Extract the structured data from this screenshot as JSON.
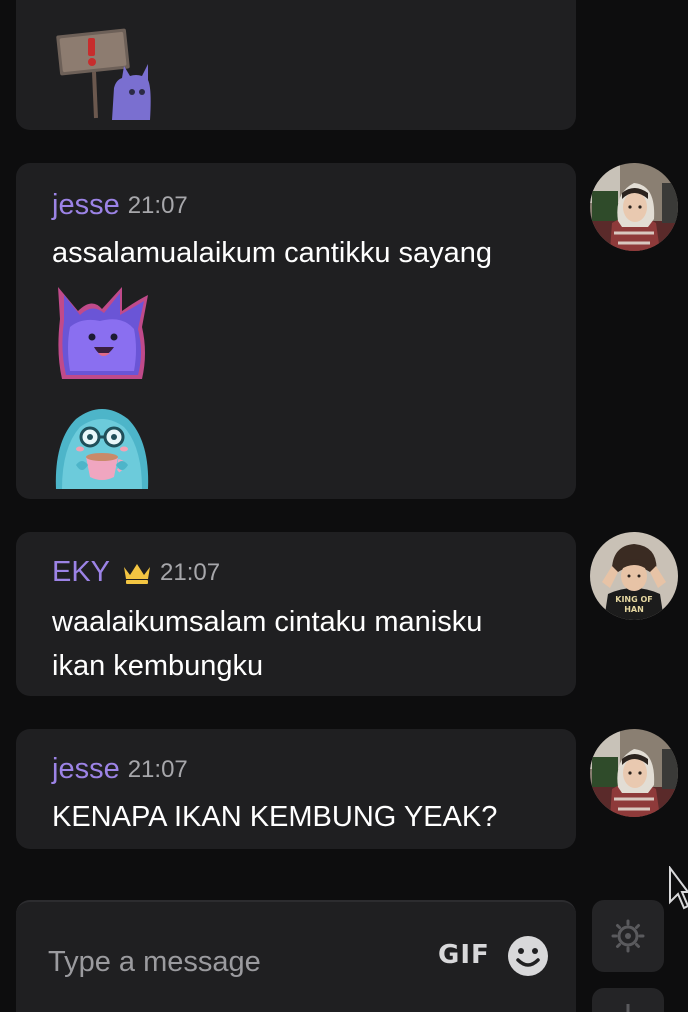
{
  "messages": [
    {
      "sender": "jesse",
      "time": "21:07",
      "text": "assalamualaikum cantikku sayang",
      "stickers": [
        "purple-flame-creature-sticker",
        "blue-creature-with-cup-sticker"
      ]
    },
    {
      "sender": "EKY",
      "badge": "crown-icon",
      "time": "21:07",
      "text_lines": [
        "waalaikumsalam cintaku manisku",
        "ikan kembungku"
      ]
    },
    {
      "sender": "jesse",
      "time": "21:07",
      "text": "KENAPA IKAN KEMBUNG YEAK?"
    }
  ],
  "composer": {
    "placeholder": "Type a message",
    "gif_label": "GIF"
  },
  "colors": {
    "background": "#0d0d0e",
    "bubble": "#1f1f21",
    "name_color": "#9c83e6",
    "crown": "#f3c542",
    "timestamp": "#a7a7ab"
  }
}
